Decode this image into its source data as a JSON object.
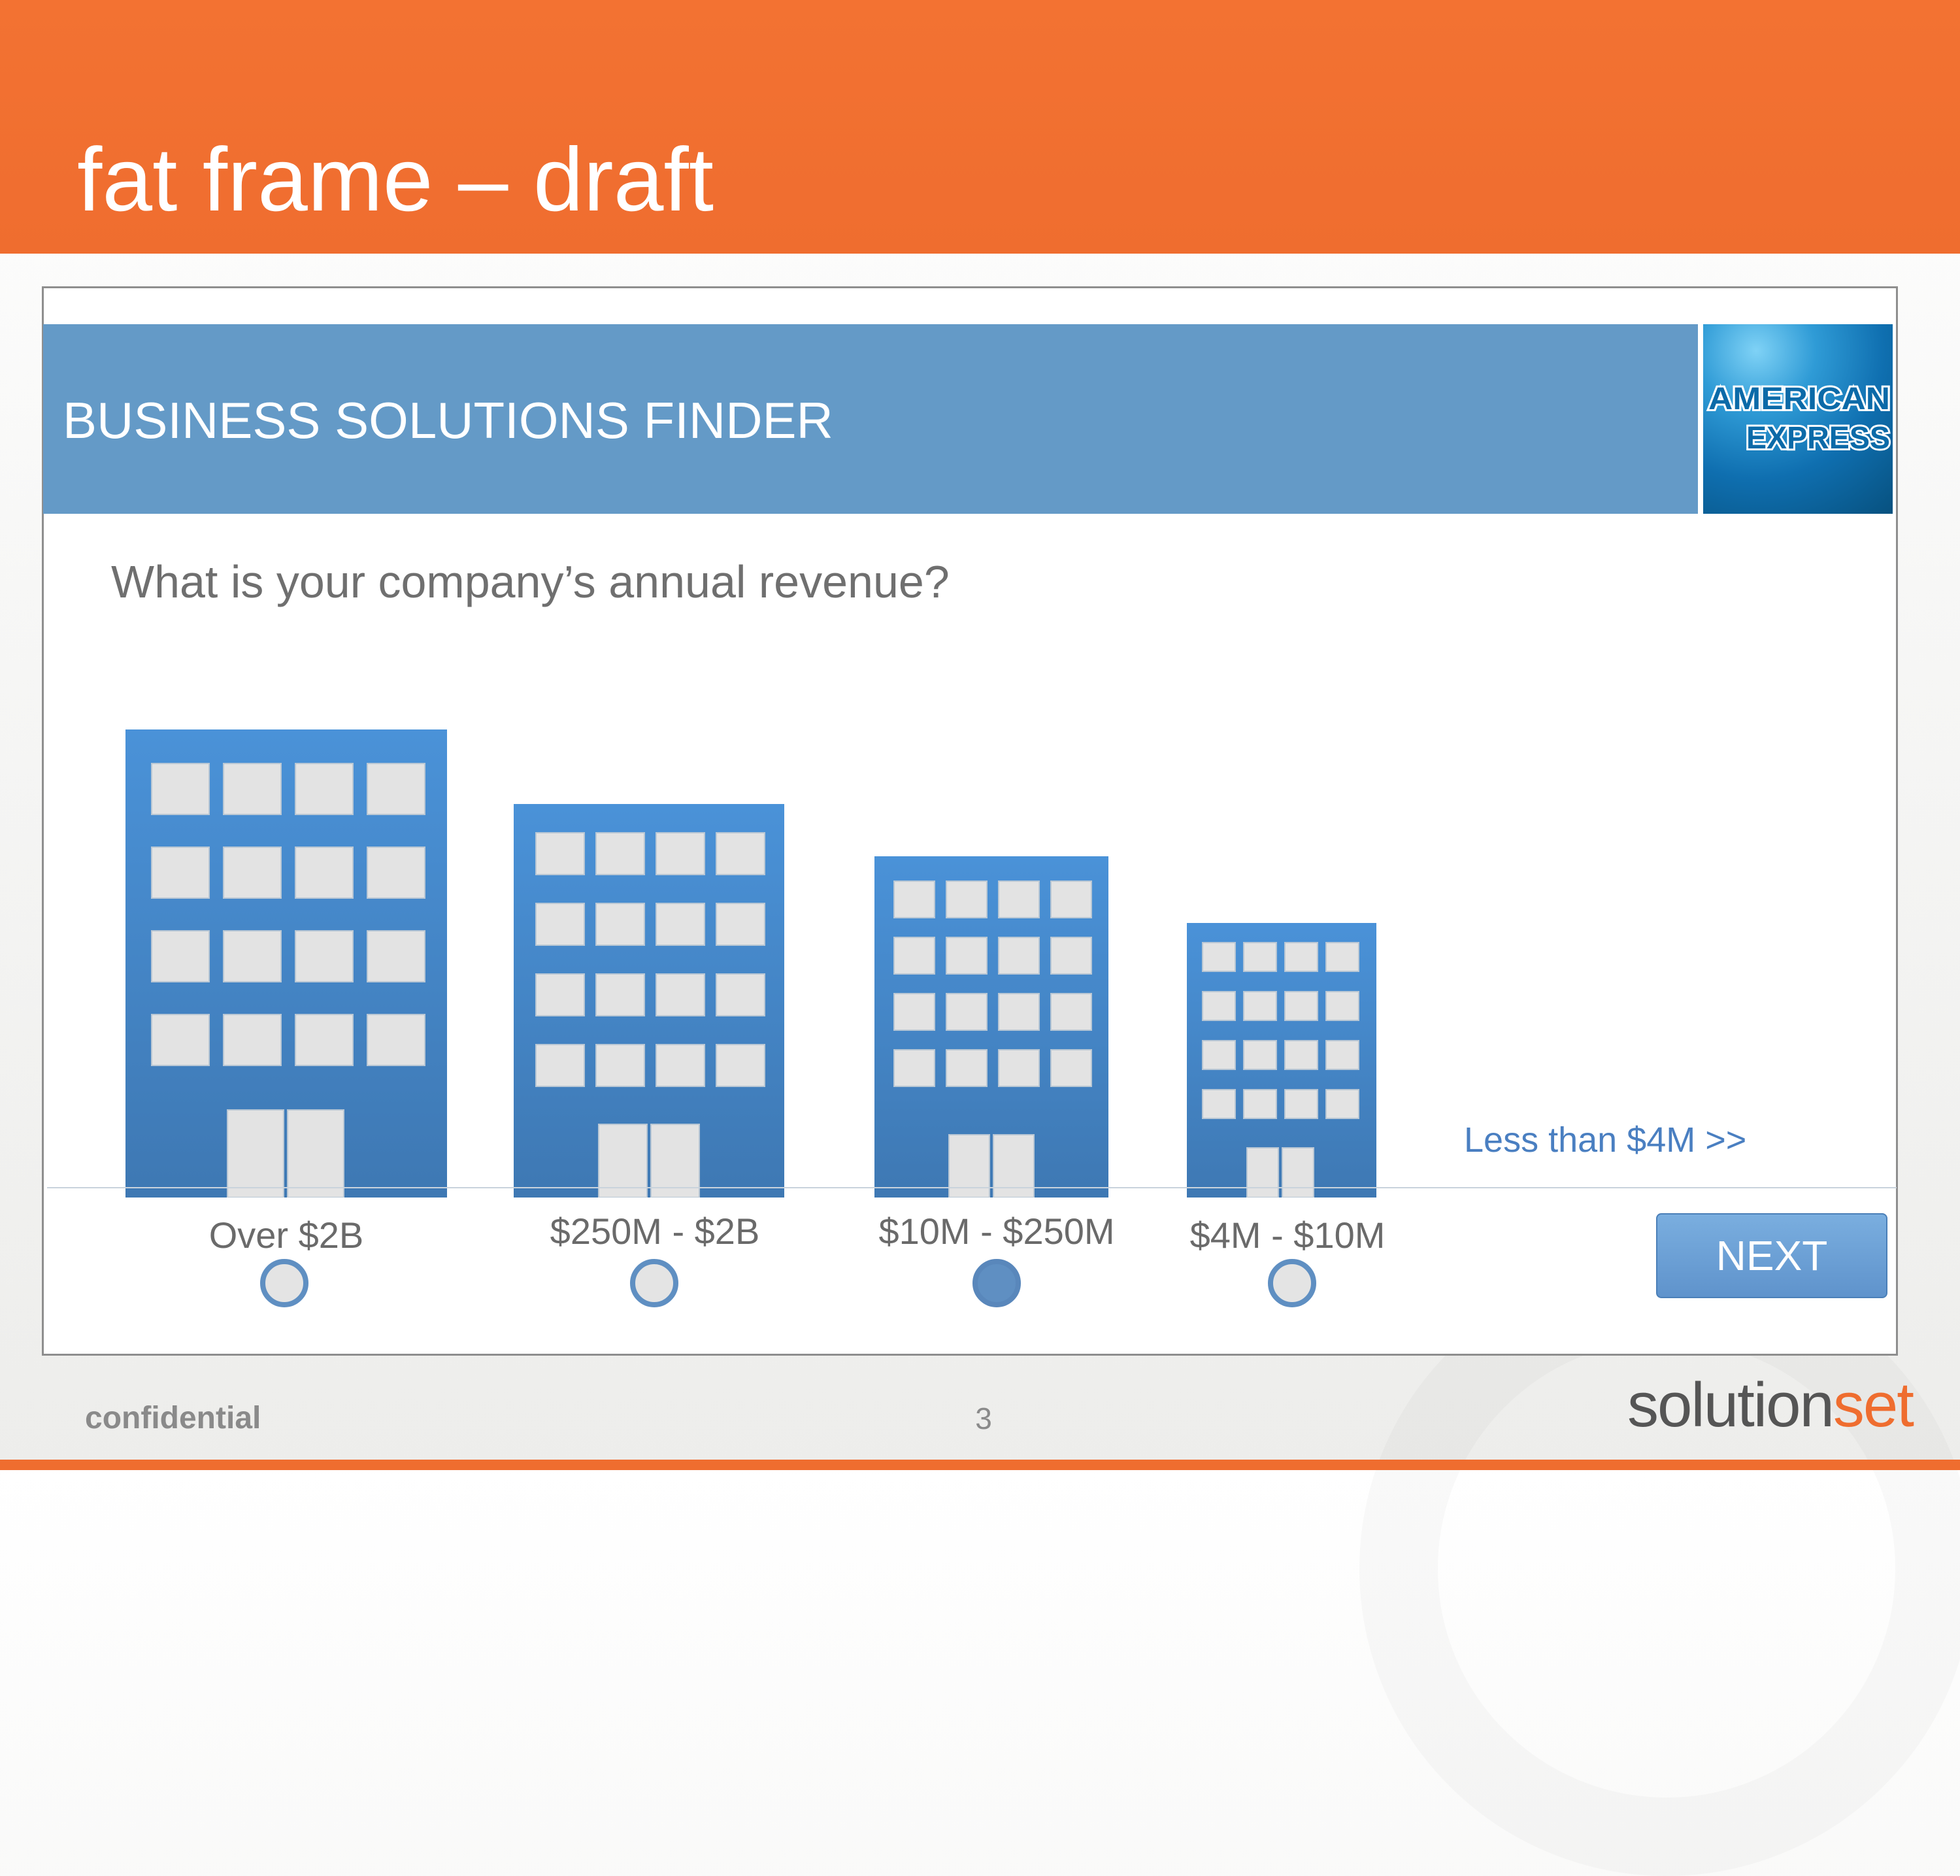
{
  "slide": {
    "title": "fat frame – draft",
    "footer_left": "confidential",
    "page_number": "3",
    "brand_logo_left": "solution",
    "brand_logo_right": "set",
    "colors": {
      "band": "#ef6d2f",
      "header": "#649ac7",
      "building": "#4a8ed0",
      "window": "#e3e3e3"
    }
  },
  "finder": {
    "header_title": "BUSINESS SOLUTIONS FINDER",
    "logo": {
      "line1": "AMERICAN",
      "line2": "EXPRESS"
    },
    "question": "What is your company’s annual revenue?",
    "options": [
      {
        "label": "Over $2B",
        "selected": false
      },
      {
        "label": "$250M - $2B",
        "selected": false
      },
      {
        "label": "$10M - $250M",
        "selected": true
      },
      {
        "label": "$4M - $10M",
        "selected": false
      }
    ],
    "less_link": "Less than $4M >>",
    "next_button": "NEXT"
  }
}
